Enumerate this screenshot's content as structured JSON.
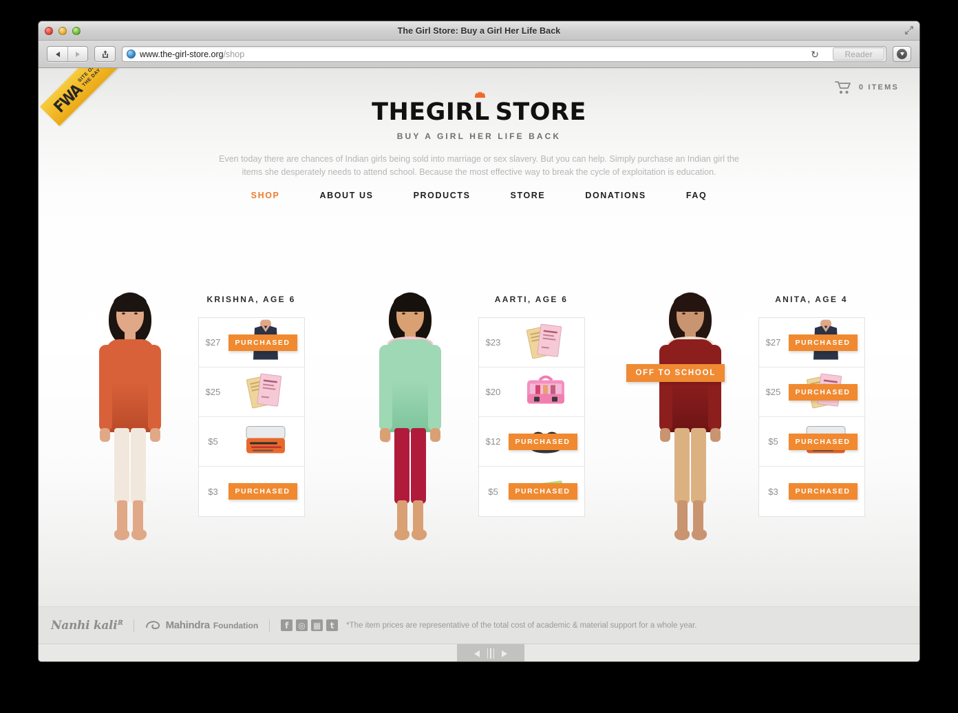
{
  "browser": {
    "window_title": "The Girl Store: Buy a Girl Her Life Back",
    "url_domain": "www.the-girl-store.org",
    "url_path": "/shop",
    "reader_label": "Reader",
    "back_icon": "back-arrow-icon",
    "forward_icon": "forward-arrow-icon",
    "share_icon": "share-icon",
    "reload_icon": "reload-icon",
    "download_icon": "download-icon",
    "fullscreen_icon": "fullscreen-icon"
  },
  "badge": {
    "fwa_logo": "FWA",
    "fwa_line1": "SITE OF",
    "fwa_line2": "THE DAY"
  },
  "cart": {
    "icon": "shopping-cart-icon",
    "label": "0 ITEMS",
    "count": 0
  },
  "brand": {
    "logo_part1": "THE",
    "logo_part2": "GIRL",
    "logo_part3": "STORE",
    "logo_full": "THE GIRL STORE",
    "tagline": "BUY A GIRL HER LIFE BACK",
    "crown_icon": "crown-icon",
    "blurb_line1": "Even today there are chances of Indian girls being sold into marriage or sex slavery. But you can help. Simply purchase an Indian girl",
    "blurb_line2": "the items she desperately needs to attend school. Because the most effective way to break the cycle of exploitation is education."
  },
  "nav": {
    "items": [
      {
        "label": "SHOP",
        "active": true
      },
      {
        "label": "ABOUT US",
        "active": false
      },
      {
        "label": "PRODUCTS",
        "active": false
      },
      {
        "label": "STORE",
        "active": false
      },
      {
        "label": "DONATIONS",
        "active": false
      },
      {
        "label": "FAQ",
        "active": false
      }
    ]
  },
  "girls": [
    {
      "name": "KRISHNA, AGE 6",
      "photo_badge": null,
      "items": [
        {
          "price": "$27",
          "product": "school-uniform",
          "status": "PURCHASED"
        },
        {
          "price": "$25",
          "product": "textbooks",
          "status": null
        },
        {
          "price": "$5",
          "product": "pencil-box",
          "status": null
        },
        {
          "price": "$3",
          "product": "stationery",
          "status": "PURCHASED"
        }
      ]
    },
    {
      "name": "AARTI, AGE 6",
      "photo_badge": null,
      "items": [
        {
          "price": "$23",
          "product": "textbooks",
          "status": null
        },
        {
          "price": "$20",
          "product": "school-bag",
          "status": null
        },
        {
          "price": "$12",
          "product": "shoes",
          "status": "PURCHASED"
        },
        {
          "price": "$5",
          "product": "notebook",
          "status": "PURCHASED"
        }
      ]
    },
    {
      "name": "ANITA, AGE 4",
      "photo_badge": "OFF TO SCHOOL",
      "items": [
        {
          "price": "$27",
          "product": "school-uniform",
          "status": "PURCHASED"
        },
        {
          "price": "$25",
          "product": "textbooks",
          "status": "PURCHASED"
        },
        {
          "price": "$5",
          "product": "pencil-box",
          "status": "PURCHASED"
        },
        {
          "price": "$3",
          "product": "stationery",
          "status": "PURCHASED"
        }
      ]
    }
  ],
  "footer": {
    "partner1": "Nanhi kali",
    "partner2_name": "Mahindra",
    "partner2_suffix": "Foundation",
    "social": [
      {
        "name": "facebook-icon",
        "glyph": "f"
      },
      {
        "name": "stumbleupon-icon",
        "glyph": "◎"
      },
      {
        "name": "qr-code-icon",
        "glyph": "▦"
      },
      {
        "name": "twitter-icon",
        "glyph": "t"
      }
    ],
    "disclaimer": "*The item prices are representative of the total cost of academic & material support for a whole year."
  },
  "scrollbar": {
    "left_arrow": "scroll-left-icon",
    "right_arrow": "scroll-right-icon",
    "grip": "drag-grip-icon"
  },
  "colors": {
    "accent_orange": "#ef7c2e",
    "badge_orange": "#f0892f",
    "text_dark": "#1d1d1d",
    "muted": "#b6b6b6"
  }
}
